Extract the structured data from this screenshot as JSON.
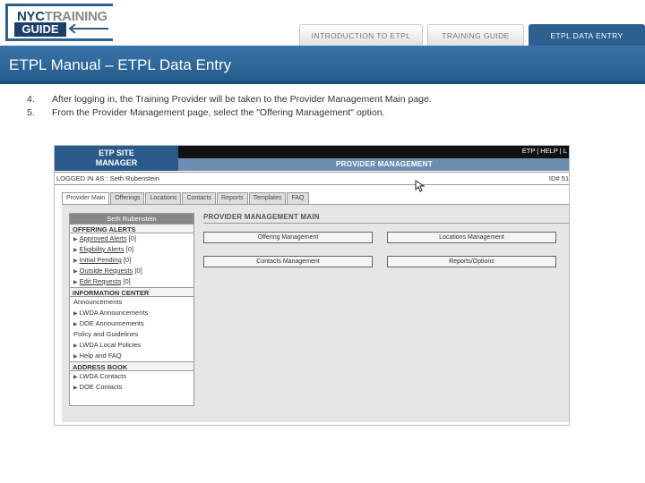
{
  "header": {
    "logo": {
      "nyc": "NYC",
      "training": "TRAINING",
      "guide": "GUIDE"
    },
    "tabs": [
      {
        "label": "INTRODUCTION TO ETPL"
      },
      {
        "label": "TRAINING GUIDE"
      },
      {
        "label": "ETPL DATA ENTRY"
      }
    ],
    "title": "ETPL Manual – ETPL Data Entry"
  },
  "steps": [
    {
      "num": "4.",
      "text": "After logging in, the Training Provider will be taken to the Provider Management Main page."
    },
    {
      "num": "5.",
      "text": "From the Provider Management page, select the  \"Offering Management\" option."
    }
  ],
  "screenshot": {
    "etp_title_line1": "ETP SITE",
    "etp_title_line2": "MANAGER",
    "top_links": "ETP | HELP | L",
    "provider_management": "PROVIDER MANAGEMENT",
    "logged_in": "LOGGED IN AS : Seth Rubenstein",
    "id_text": "ID# 51",
    "subtabs": [
      "Provider Main",
      "Offerings",
      "Locations",
      "Contacts",
      "Reports",
      "Templates",
      "FAQ"
    ],
    "left": {
      "user_name": "Seth Rubenstein",
      "offering_alerts_title": "OFFERING ALERTS",
      "offering_alerts": [
        {
          "label": "Approved Alerts",
          "count": "[0]"
        },
        {
          "label": "Eligibility Alerts",
          "count": "[0]"
        },
        {
          "label": "Initial Pending",
          "count": "[0]"
        },
        {
          "label": "Outside Requests",
          "count": "[0]"
        },
        {
          "label": "Edit Requests",
          "count": "[0]"
        }
      ],
      "info_center_title": "INFORMATION CENTER",
      "info_center": [
        {
          "label": "Announcements",
          "arrow": false
        },
        {
          "label": "LWDA Announcements",
          "arrow": true
        },
        {
          "label": "DOE Announcements",
          "arrow": true
        },
        {
          "label": "Policy and Guidelines",
          "arrow": false
        },
        {
          "label": "LWDA Local Policies",
          "arrow": true
        },
        {
          "label": "Help and FAQ",
          "arrow": true
        }
      ],
      "address_book_title": "ADDRESS BOOK",
      "address_book": [
        {
          "label": "LWDA Contacts"
        },
        {
          "label": "DOE Contacts"
        }
      ]
    },
    "right": {
      "title": "PROVIDER MANAGEMENT MAIN",
      "buttons_row1": [
        "Offering Management",
        "Locations Management"
      ],
      "buttons_row2": [
        "Contacts Management",
        "Reports/Options"
      ]
    }
  },
  "colors": {
    "brand_blue": "#2d5f8f",
    "title_bar": "#3b74a9"
  }
}
